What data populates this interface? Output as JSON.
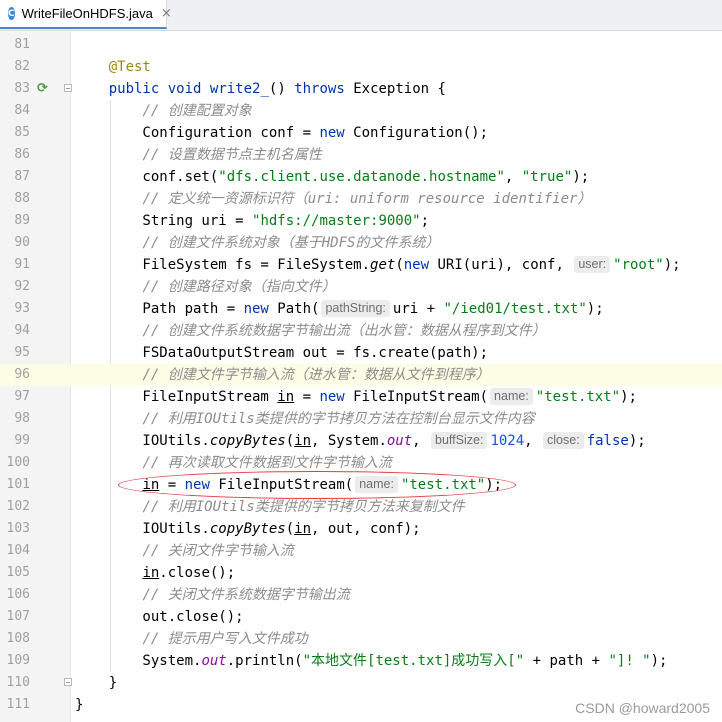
{
  "tab": {
    "icon_letter": "C",
    "label": "WriteFileOnHDFS.java",
    "close": "×"
  },
  "watermark": "CSDN @howard2005",
  "lines": [
    {
      "n": "81",
      "tokens": []
    },
    {
      "n": "82",
      "tokens": [
        {
          "t": "    "
        },
        {
          "t": "@Test",
          "c": "ann"
        }
      ]
    },
    {
      "n": "83",
      "run": true,
      "fold": true,
      "tokens": [
        {
          "t": "    "
        },
        {
          "t": "public",
          "c": "kw"
        },
        {
          "t": " "
        },
        {
          "t": "void",
          "c": "kw"
        },
        {
          "t": " "
        },
        {
          "t": "write2_",
          "c": "kw"
        },
        {
          "t": "() "
        },
        {
          "t": "throws",
          "c": "kw"
        },
        {
          "t": " Exception {"
        }
      ]
    },
    {
      "n": "84",
      "tokens": [
        {
          "t": "        "
        },
        {
          "t": "// 创建配置对象",
          "c": "cmt"
        }
      ]
    },
    {
      "n": "85",
      "tokens": [
        {
          "t": "        Configuration conf = "
        },
        {
          "t": "new",
          "c": "kw"
        },
        {
          "t": " Configuration();"
        }
      ]
    },
    {
      "n": "86",
      "tokens": [
        {
          "t": "        "
        },
        {
          "t": "// 设置数据节点主机名属性",
          "c": "cmt"
        }
      ]
    },
    {
      "n": "87",
      "tokens": [
        {
          "t": "        conf.set("
        },
        {
          "t": "\"dfs.client.use.datanode.hostname\"",
          "c": "str"
        },
        {
          "t": ", "
        },
        {
          "t": "\"true\"",
          "c": "str"
        },
        {
          "t": ");"
        }
      ]
    },
    {
      "n": "88",
      "tokens": [
        {
          "t": "        "
        },
        {
          "t": "// 定义统一资源标识符（uri: uniform resource identifier）",
          "c": "cmt"
        }
      ]
    },
    {
      "n": "89",
      "tokens": [
        {
          "t": "        String uri = "
        },
        {
          "t": "\"hdfs://master:9000\"",
          "c": "str"
        },
        {
          "t": ";"
        }
      ]
    },
    {
      "n": "90",
      "tokens": [
        {
          "t": "        "
        },
        {
          "t": "// 创建文件系统对象（基于HDFS的文件系统）",
          "c": "cmt"
        }
      ]
    },
    {
      "n": "91",
      "tokens": [
        {
          "t": "        FileSystem fs = FileSystem."
        },
        {
          "t": "get",
          "c": "stat"
        },
        {
          "t": "("
        },
        {
          "t": "new",
          "c": "kw"
        },
        {
          "t": " URI(uri), conf, "
        },
        {
          "h": "user:"
        },
        {
          "t": "\"root\"",
          "c": "str"
        },
        {
          "t": ");"
        }
      ]
    },
    {
      "n": "92",
      "tokens": [
        {
          "t": "        "
        },
        {
          "t": "// 创建路径对象（指向文件）",
          "c": "cmt"
        }
      ]
    },
    {
      "n": "93",
      "tokens": [
        {
          "t": "        Path path = "
        },
        {
          "t": "new",
          "c": "kw"
        },
        {
          "t": " Path("
        },
        {
          "h": "pathString:"
        },
        {
          "t": "uri + "
        },
        {
          "t": "\"/ied01/test.txt\"",
          "c": "str"
        },
        {
          "t": ");"
        }
      ]
    },
    {
      "n": "94",
      "tokens": [
        {
          "t": "        "
        },
        {
          "t": "// 创建文件系统数据字节输出流（出水管：数据从程序到文件）",
          "c": "cmt"
        }
      ]
    },
    {
      "n": "95",
      "tokens": [
        {
          "t": "        FSDataOutputStream out = fs.create(path);"
        }
      ]
    },
    {
      "n": "96",
      "current": true,
      "tokens": [
        {
          "t": "        "
        },
        {
          "t": "// 创建文件字节输入流（进水管：数据从文件到程序）",
          "c": "cmt"
        }
      ]
    },
    {
      "n": "97",
      "tokens": [
        {
          "t": "        FileInputStream "
        },
        {
          "t": "in",
          "c": "ul"
        },
        {
          "t": " = "
        },
        {
          "t": "new",
          "c": "kw"
        },
        {
          "t": " FileInputStream("
        },
        {
          "h": "name:"
        },
        {
          "t": "\"test.txt\"",
          "c": "str"
        },
        {
          "t": ");"
        }
      ]
    },
    {
      "n": "98",
      "tokens": [
        {
          "t": "        "
        },
        {
          "t": "// 利用IOUtils类提供的字节拷贝方法在控制台显示文件内容",
          "c": "cmt"
        }
      ]
    },
    {
      "n": "99",
      "tokens": [
        {
          "t": "        IOUtils."
        },
        {
          "t": "copyBytes",
          "c": "stat"
        },
        {
          "t": "("
        },
        {
          "t": "in",
          "c": "ul"
        },
        {
          "t": ", System."
        },
        {
          "t": "out",
          "c": "fld"
        },
        {
          "t": ", "
        },
        {
          "h": "buffSize:"
        },
        {
          "t": "1024",
          "c": "num"
        },
        {
          "t": ", "
        },
        {
          "h": "close:"
        },
        {
          "t": "false",
          "c": "kw"
        },
        {
          "t": ");"
        }
      ]
    },
    {
      "n": "100",
      "tokens": [
        {
          "t": "        "
        },
        {
          "t": "// 再次读取文件数据到文件字节输入流",
          "c": "cmt"
        }
      ]
    },
    {
      "n": "101",
      "tokens": [
        {
          "t": "        "
        },
        {
          "t": "in",
          "c": "ul"
        },
        {
          "t": " = "
        },
        {
          "t": "new",
          "c": "kw"
        },
        {
          "t": " FileInputStream("
        },
        {
          "h": "name:"
        },
        {
          "t": "\"test.txt\"",
          "c": "str"
        },
        {
          "t": ");"
        }
      ]
    },
    {
      "n": "102",
      "tokens": [
        {
          "t": "        "
        },
        {
          "t": "// 利用IOUtils类提供的字节拷贝方法来复制文件",
          "c": "cmt"
        }
      ]
    },
    {
      "n": "103",
      "tokens": [
        {
          "t": "        IOUtils."
        },
        {
          "t": "copyBytes",
          "c": "stat"
        },
        {
          "t": "("
        },
        {
          "t": "in",
          "c": "ul"
        },
        {
          "t": ", out, conf);"
        }
      ]
    },
    {
      "n": "104",
      "tokens": [
        {
          "t": "        "
        },
        {
          "t": "// 关闭文件字节输入流",
          "c": "cmt"
        }
      ]
    },
    {
      "n": "105",
      "tokens": [
        {
          "t": "        "
        },
        {
          "t": "in",
          "c": "ul"
        },
        {
          "t": ".close();"
        }
      ]
    },
    {
      "n": "106",
      "tokens": [
        {
          "t": "        "
        },
        {
          "t": "// 关闭文件系统数据字节输出流",
          "c": "cmt"
        }
      ]
    },
    {
      "n": "107",
      "tokens": [
        {
          "t": "        out.close();"
        }
      ]
    },
    {
      "n": "108",
      "tokens": [
        {
          "t": "        "
        },
        {
          "t": "// 提示用户写入文件成功",
          "c": "cmt"
        }
      ]
    },
    {
      "n": "109",
      "tokens": [
        {
          "t": "        System."
        },
        {
          "t": "out",
          "c": "fld"
        },
        {
          "t": ".println("
        },
        {
          "t": "\"本地文件[test.txt]成功写入[\"",
          "c": "str"
        },
        {
          "t": " + path + "
        },
        {
          "t": "\"]! \"",
          "c": "str"
        },
        {
          "t": ");"
        }
      ]
    },
    {
      "n": "110",
      "fold": true,
      "tokens": [
        {
          "t": "    }"
        }
      ]
    },
    {
      "n": "111",
      "tokens": [
        {
          "t": "}"
        }
      ]
    }
  ]
}
